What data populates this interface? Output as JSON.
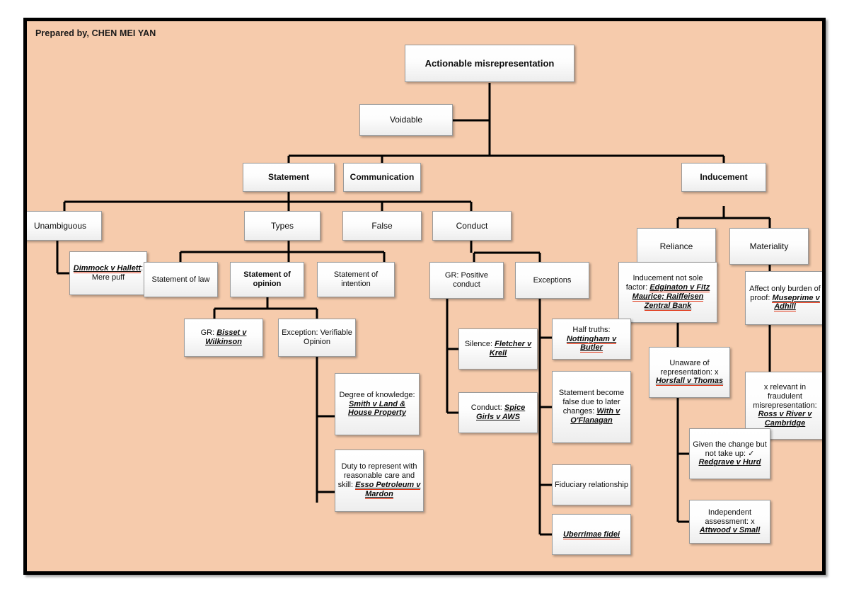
{
  "slide": {
    "prepared_by": "Prepared by, CHEN MEI YAN",
    "background_color": "#f6cbac",
    "border_color": "#000000",
    "node_fill": "#ffffff",
    "spellcheck_underline_color": "#e03010"
  },
  "nodes": {
    "root": "Actionable misrepresentation",
    "voidable": "Voidable",
    "statement": "Statement",
    "communication": "Communication",
    "inducement": "Inducement",
    "unambiguous": "Unambiguous",
    "types": "Types",
    "false": "False",
    "conduct": "Conduct",
    "reliance": "Reliance",
    "materiality": "Materiality",
    "dimmock": {
      "case": "Dimmock v Hallett",
      "rest": ": Mere puff"
    },
    "statement_of_law": "Statement of law",
    "statement_of_opinion": "Statement of opinion",
    "statement_of_intention": "Statement of intention",
    "gr_positive_conduct": "GR: Positive conduct",
    "exceptions": "Exceptions",
    "inducement_not_sole": {
      "lead": "Inducement not sole factor: ",
      "case": "Edginaton v Fitz Maurice; Raiffeisen Zentral Bank"
    },
    "affect_burden": {
      "lead": "Affect only burden of proof: ",
      "case": "Museprime v Adhill"
    },
    "gr_bisset": {
      "lead": "GR: ",
      "case": "Bisset v Wilkinson"
    },
    "exception_verifiable": "Exception: Verifiable Opinion",
    "silence": {
      "lead": "Silence: ",
      "case": "Fletcher v Krell"
    },
    "half_truths": {
      "lead": "Half truths: ",
      "case": "Nottingham v Butler"
    },
    "unaware": {
      "lead": "Unaware of representation: x ",
      "case": "Horsfall v Thomas"
    },
    "degree_of_knowledge": {
      "lead": "Degree of knowledge: ",
      "case": "Smith v Land & House Property"
    },
    "statement_become_false": {
      "lead": "Statement become false due to later changes: ",
      "case": "With v O'Flanagan"
    },
    "x_relevant_fraudulent": {
      "lead": "x relevant in fraudulent misrepresentation: ",
      "case": "Ross v River v Cambridge"
    },
    "conduct_spice_girls": {
      "lead": "Conduct: ",
      "case": "Spice Girls v AWS"
    },
    "given_change": {
      "lead": "Given the change but not take up: ✓ ",
      "case": "Redgrave v Hurd"
    },
    "fiduciary": "Fiduciary relationship",
    "independent_assessment": {
      "lead": "Independent assessment: x ",
      "case": "Attwood v Small"
    },
    "uberrimae": {
      "case": "Uberrimae fidei"
    }
  }
}
